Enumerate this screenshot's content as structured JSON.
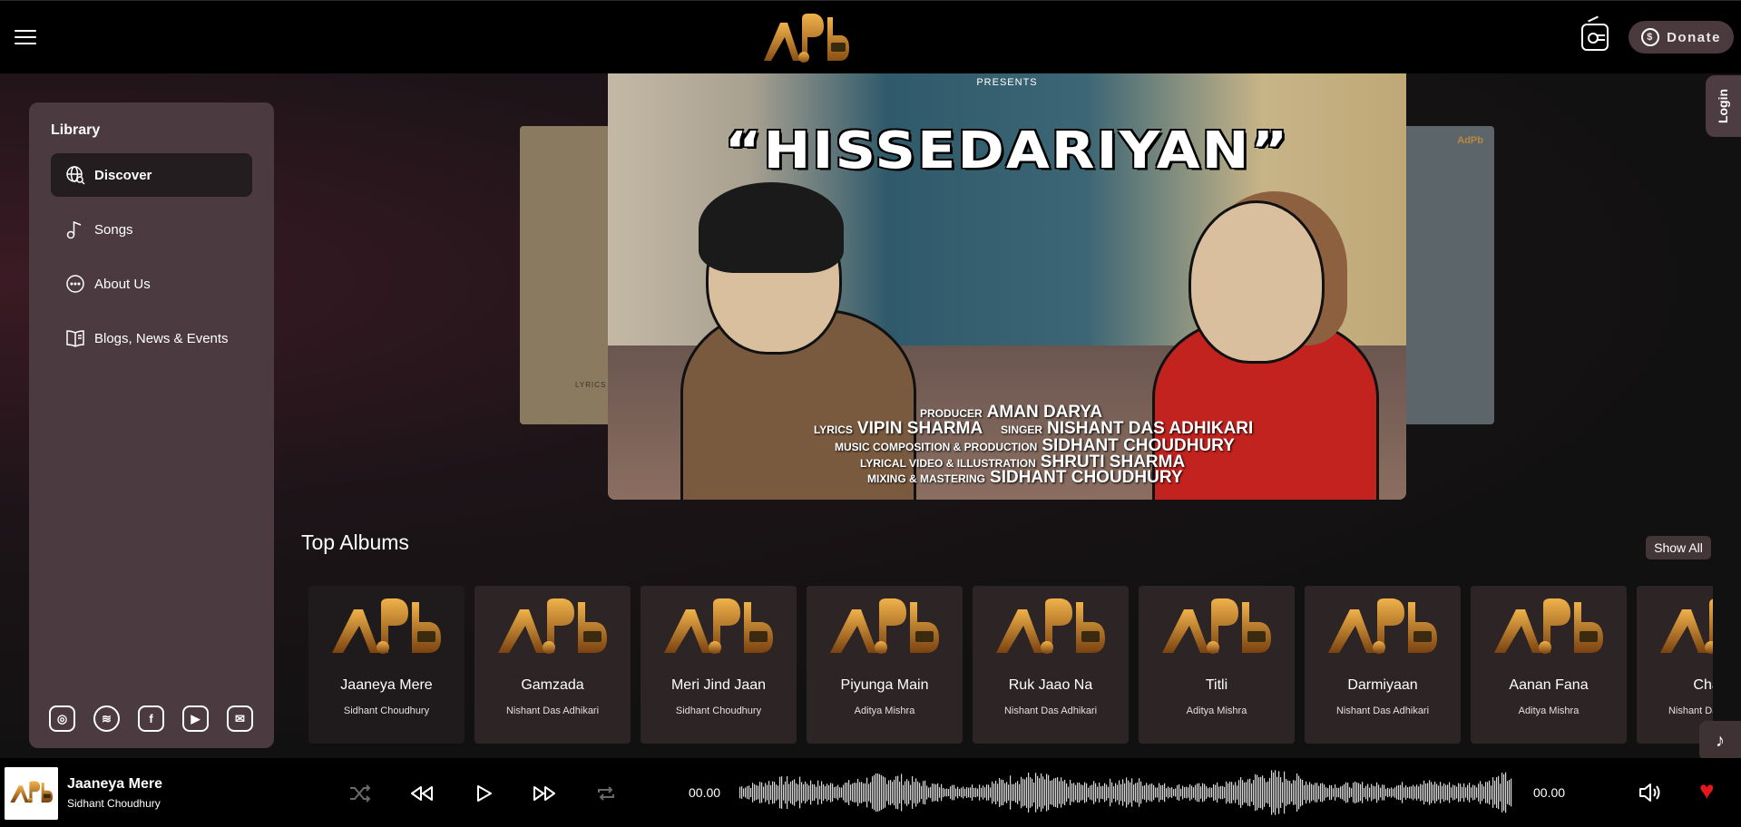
{
  "header": {
    "menu_icon": "hamburger-icon",
    "logo_text": "AdPb",
    "radio_icon": "radio-icon",
    "donate_label": "Donate",
    "donate_icon": "dollar-circle-icon"
  },
  "sidebar": {
    "title": "Library",
    "items": [
      {
        "label": "Discover",
        "icon": "globe-search-icon",
        "active": true
      },
      {
        "label": "Songs",
        "icon": "music-note-icon",
        "active": false
      },
      {
        "label": "About Us",
        "icon": "more-circle-icon",
        "active": false
      },
      {
        "label": "Blogs, News & Events",
        "icon": "book-icon",
        "active": false
      }
    ],
    "socials": [
      "instagram-icon",
      "spotify-icon",
      "facebook-icon",
      "youtube-icon",
      "mail-icon"
    ]
  },
  "carousel": {
    "presents": "PRESENTS",
    "title": "“HISSEDARIYAN”",
    "left_slide_text": "LYRICS",
    "credits": [
      {
        "label": "PRODUCER",
        "value": "AMAN DARYA"
      },
      {
        "label": "LYRICS",
        "value": "VIPIN SHARMA"
      },
      {
        "label": "SINGER",
        "value": "NISHANT DAS ADHIKARI"
      },
      {
        "label": "MUSIC COMPOSITION & PRODUCTION",
        "value": "SIDHANT CHOUDHURY"
      },
      {
        "label": "LYRICAL VIDEO & ILLUSTRATION",
        "value": "SHRUTI SHARMA"
      },
      {
        "label": "MIXING & MASTERING",
        "value": "SIDHANT CHOUDHURY"
      }
    ]
  },
  "top_albums": {
    "title": "Top Albums",
    "show_all": "Show All",
    "albums": [
      {
        "name": "Jaaneya Mere",
        "artist": "Sidhant Choudhury"
      },
      {
        "name": "Gamzada",
        "artist": "Nishant Das Adhikari"
      },
      {
        "name": "Meri Jind Jaan",
        "artist": "Sidhant Choudhury"
      },
      {
        "name": "Piyunga Main",
        "artist": "Aditya Mishra"
      },
      {
        "name": "Ruk Jaao Na",
        "artist": "Nishant Das Adhikari"
      },
      {
        "name": "Titli",
        "artist": "Aditya Mishra"
      },
      {
        "name": "Darmiyaan",
        "artist": "Nishant Das Adhikari"
      },
      {
        "name": "Aanan Fana",
        "artist": "Aditya Mishra"
      },
      {
        "name": "Chand",
        "artist": "Nishant Das Adhikari"
      }
    ]
  },
  "side_tabs": {
    "login": "Login",
    "music_icon": "music-note-icon"
  },
  "player": {
    "title": "Jaaneya Mere",
    "artist": "Sidhant Choudhury",
    "current_time": "00.00",
    "total_time": "00.00",
    "controls": [
      "shuffle-icon",
      "rewind-icon",
      "play-icon",
      "fast-forward-icon",
      "repeat-icon"
    ],
    "volume_icon": "volume-icon",
    "favorite_icon": "heart-icon",
    "favorite_color": "#e3171d"
  }
}
